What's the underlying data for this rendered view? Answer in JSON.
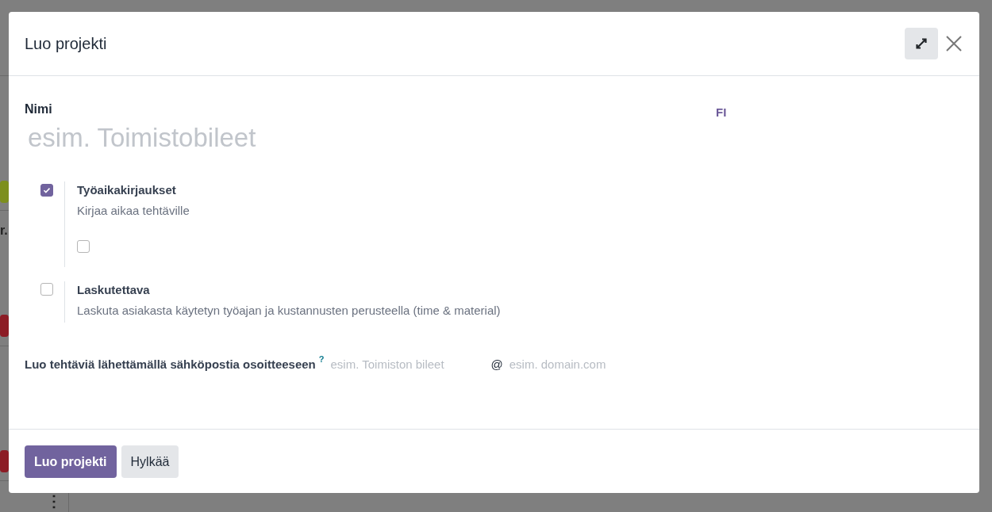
{
  "background": {
    "text": "r.",
    "menu": "⋮",
    "tags": [
      {
        "color": "#7d8f1e"
      },
      {
        "color": "#8c1c25"
      },
      {
        "color": "#8c1c25"
      }
    ]
  },
  "dialog": {
    "title": "Luo projekti",
    "name_field": {
      "label": "Nimi",
      "placeholder": "esim. Toimistobileet",
      "language": "FI"
    },
    "options": [
      {
        "label": "Työaikakirjaukset",
        "description": "Kirjaa aikaa tehtäville",
        "checked": true,
        "sub_checkbox": {
          "checked": false
        }
      },
      {
        "label": "Laskutettava",
        "description": "Laskuta asiakasta käytetyn työajan ja kustannusten perusteella (time & material)",
        "checked": false
      }
    ],
    "email": {
      "label": "Luo tehtäviä lähettämällä sähköpostia osoitteeseen",
      "help": "?",
      "alias_placeholder": "esim. Toimiston bileet",
      "at": "@",
      "domain_placeholder": "esim. domain.com"
    },
    "buttons": [
      {
        "label": "Luo projekti",
        "kind": "primary"
      },
      {
        "label": "Hylkää",
        "kind": "secondary"
      }
    ]
  }
}
